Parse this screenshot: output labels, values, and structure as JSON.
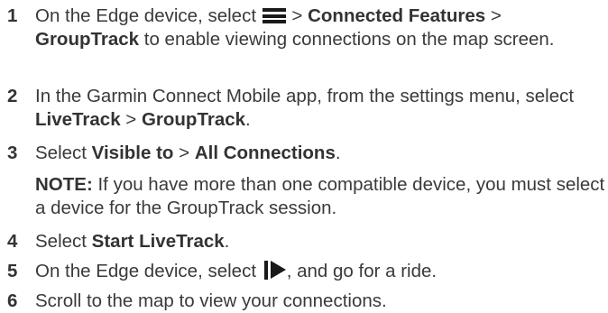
{
  "steps": [
    {
      "number": "1",
      "t1": "On the Edge device, select ",
      "icon": "menu-icon",
      "t2": " > ",
      "b1": "Connected Features",
      "t3": " > ",
      "b2": "GroupTrack",
      "t4": " to enable viewing connections on the map screen."
    },
    {
      "number": "2",
      "t1": "In the Garmin Connect Mobile app, from the settings menu, select ",
      "b1": "LiveTrack",
      "t2": " > ",
      "b2": "GroupTrack",
      "t3": "."
    },
    {
      "number": "3",
      "t1": "Select ",
      "b1": "Visible to",
      "t2": " > ",
      "b2": "All Connections",
      "t3": ".",
      "note_label": "NOTE:",
      "note_text": " If you have more than one compatible device, you must select a device for the GroupTrack session."
    },
    {
      "number": "4",
      "t1": "Select ",
      "b1": "Start LiveTrack",
      "t2": "."
    },
    {
      "number": "5",
      "t1": "On the Edge device, select ",
      "icon": "start-icon",
      "t2": ", and go for a ride."
    },
    {
      "number": "6",
      "t1": "Scroll to the map to view your connections."
    }
  ],
  "colors": {
    "text": "#3a3a3a",
    "bold": "#333333",
    "icon": "#1a1a1a"
  }
}
